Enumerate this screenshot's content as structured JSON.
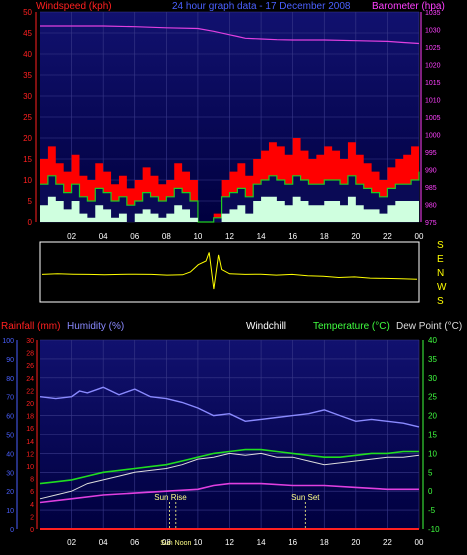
{
  "colors": {
    "background": "#000000",
    "panel_top": "#10106e",
    "panel_bottom": "#000048",
    "grid": "#3a3a8a",
    "axis_red": "#ff2020",
    "axis_magenta": "#ff40ff",
    "axis_blue": "#4a60ff",
    "axis_green": "#40ff40",
    "axis_white": "#ffffff",
    "axis_yellow": "#ffff00",
    "humidity": "#8a8aff",
    "temperature": "#20dd20",
    "dew_point": "#dddddd",
    "barometer": "#e040e0",
    "wind_gust": "#ff0000",
    "wind_avg": "#20cc20",
    "wind_low": "#cfffdf",
    "wind_dir": "#ffff00"
  },
  "header": {
    "windspeed_label": "Windspeed (kph)",
    "title": "24 hour graph data - 17 December 2008",
    "barometer_label": "Barometer (hpa)"
  },
  "bottom_header": {
    "rainfall_label": "Rainfall (mm)",
    "humidity_label": "Humidity (%)",
    "windchill_label": "Windchill",
    "temperature_label": "Temperature (°C)",
    "dewpoint_label": "Dew Point (°C)"
  },
  "direction_labels": [
    "S",
    "E",
    "N",
    "W",
    "S"
  ],
  "annotations": {
    "sunrise": "Sun Rise",
    "sunset": "Sun Set",
    "noon": "Sun Noon"
  },
  "chart_data": [
    {
      "type": "area",
      "panel": "wind_and_pressure",
      "x_ticks": [
        "02",
        "04",
        "06",
        "08",
        "10",
        "12",
        "14",
        "16",
        "18",
        "20",
        "22",
        "00"
      ],
      "left_axis": {
        "label": "Windspeed (kph)",
        "ylim": [
          0,
          50
        ],
        "ticks": [
          0,
          5,
          10,
          15,
          20,
          25,
          30,
          35,
          40,
          45,
          50
        ]
      },
      "right_axis": {
        "label": "Barometer (hpa)",
        "ylim": [
          975,
          1035
        ],
        "ticks": [
          975,
          980,
          985,
          990,
          995,
          1000,
          1005,
          1010,
          1015,
          1020,
          1025,
          1030,
          1035
        ]
      },
      "series": [
        {
          "name": "Barometer (hpa)",
          "axis": "right",
          "x": [
            0,
            2,
            4,
            6,
            8,
            10,
            11,
            12,
            12.5,
            13,
            14,
            15,
            16,
            18,
            20,
            22,
            23,
            24
          ],
          "values": [
            1031,
            1031,
            1031,
            1030.8,
            1030.5,
            1030.3,
            1029.5,
            1028.5,
            1028,
            1027.5,
            1027.3,
            1027.1,
            1027,
            1027,
            1026.8,
            1026.6,
            1026.3,
            1026
          ]
        },
        {
          "name": "gust",
          "axis": "left",
          "x": [
            0,
            0.5,
            1,
            1.5,
            2,
            2.5,
            3,
            3.5,
            4,
            4.5,
            5,
            5.5,
            6,
            6.5,
            7,
            7.5,
            8,
            8.5,
            9,
            9.5,
            10,
            10.5,
            11,
            11.5,
            12,
            12.5,
            13,
            13.5,
            14,
            14.5,
            15,
            15.5,
            16,
            16.5,
            17,
            17.5,
            18,
            18.5,
            19,
            19.5,
            20,
            20.5,
            21,
            21.5,
            22,
            22.5,
            23,
            23.5,
            24
          ],
          "values": [
            15,
            18,
            14,
            12,
            16,
            11,
            10,
            14,
            12,
            9,
            11,
            8,
            10,
            13,
            11,
            9,
            10,
            14,
            12,
            10,
            0,
            0,
            2,
            10,
            12,
            14,
            11,
            15,
            17,
            19,
            18,
            16,
            20,
            17,
            15,
            16,
            18,
            17,
            15,
            19,
            16,
            14,
            12,
            10,
            13,
            15,
            16,
            18,
            20
          ]
        },
        {
          "name": "average",
          "axis": "left",
          "x": [
            0,
            0.5,
            1,
            1.5,
            2,
            2.5,
            3,
            3.5,
            4,
            4.5,
            5,
            5.5,
            6,
            6.5,
            7,
            7.5,
            8,
            8.5,
            9,
            9.5,
            10,
            10.5,
            11,
            11.5,
            12,
            12.5,
            13,
            13.5,
            14,
            14.5,
            15,
            15.5,
            16,
            16.5,
            17,
            17.5,
            18,
            18.5,
            19,
            19.5,
            20,
            20.5,
            21,
            21.5,
            22,
            22.5,
            23,
            23.5,
            24
          ],
          "values": [
            9,
            11,
            9,
            7,
            9,
            6,
            5,
            8,
            7,
            5,
            6,
            4,
            5,
            7,
            6,
            5,
            6,
            8,
            7,
            5,
            0,
            0,
            1,
            6,
            7,
            8,
            6,
            9,
            10,
            11,
            10,
            9,
            11,
            10,
            9,
            9,
            10,
            10,
            9,
            11,
            9,
            8,
            7,
            6,
            8,
            9,
            9,
            10,
            12
          ]
        },
        {
          "name": "low",
          "axis": "left",
          "x": [
            0,
            0.5,
            1,
            1.5,
            2,
            2.5,
            3,
            3.5,
            4,
            4.5,
            5,
            5.5,
            6,
            6.5,
            7,
            7.5,
            8,
            8.5,
            9,
            9.5,
            10,
            10.5,
            11,
            11.5,
            12,
            12.5,
            13,
            13.5,
            14,
            14.5,
            15,
            15.5,
            16,
            16.5,
            17,
            17.5,
            18,
            18.5,
            19,
            19.5,
            20,
            20.5,
            21,
            21.5,
            22,
            22.5,
            23,
            23.5,
            24
          ],
          "values": [
            4,
            6,
            5,
            3,
            5,
            2,
            1,
            4,
            3,
            1,
            2,
            0,
            2,
            3,
            2,
            1,
            2,
            4,
            3,
            1,
            0,
            0,
            0,
            2,
            3,
            4,
            2,
            5,
            6,
            6,
            5,
            4,
            6,
            5,
            4,
            4,
            5,
            5,
            4,
            6,
            4,
            3,
            3,
            2,
            4,
            5,
            5,
            5,
            7
          ]
        }
      ]
    },
    {
      "type": "line",
      "panel": "wind_direction",
      "y_categories": [
        "S",
        "E",
        "N",
        "W",
        "S"
      ],
      "ylim": [
        0,
        360
      ],
      "series": [
        {
          "name": "direction",
          "x": [
            0,
            1,
            2,
            3,
            4,
            5,
            6,
            7,
            8,
            9,
            9.5,
            10,
            10.5,
            10.7,
            11,
            11.3,
            11.5,
            12,
            13,
            14,
            15,
            16,
            17,
            18,
            19,
            20,
            21,
            22,
            23,
            24
          ],
          "values": [
            200,
            195,
            198,
            200,
            202,
            200,
            198,
            200,
            205,
            203,
            180,
            120,
            90,
            20,
            320,
            40,
            160,
            195,
            200,
            198,
            205,
            200,
            210,
            215,
            225,
            220,
            230,
            232,
            235,
            240
          ]
        }
      ]
    },
    {
      "type": "line",
      "panel": "temperature_humidity",
      "x_ticks": [
        "02",
        "04",
        "06",
        "08",
        "10",
        "12",
        "14",
        "16",
        "18",
        "20",
        "22",
        "00"
      ],
      "left_axes": [
        {
          "label": "Rainfall (mm)",
          "ylim": [
            0,
            30
          ],
          "ticks": [
            0,
            2,
            4,
            6,
            8,
            10,
            12,
            14,
            16,
            18,
            20,
            22,
            24,
            26,
            28,
            30
          ]
        },
        {
          "label": "Humidity (%)",
          "ylim": [
            0,
            100
          ],
          "ticks": [
            0,
            10,
            20,
            30,
            40,
            50,
            60,
            70,
            80,
            90,
            100
          ]
        }
      ],
      "right_axis": {
        "label": "Temperature (°C)",
        "ylim": [
          -10,
          40
        ],
        "ticks": [
          -10,
          -5,
          0,
          5,
          10,
          15,
          20,
          25,
          30,
          35,
          40
        ]
      },
      "series": [
        {
          "name": "Humidity (%)",
          "axis": "humidity",
          "x": [
            0,
            1,
            2,
            2.5,
            3,
            4,
            5,
            6,
            7,
            8,
            9,
            10,
            11,
            12,
            13,
            14,
            15,
            16,
            17,
            18,
            19,
            20,
            21,
            22,
            23,
            24
          ],
          "values": [
            70,
            69,
            70,
            73,
            72,
            75,
            71,
            74,
            70,
            69,
            67,
            64,
            60,
            61,
            57,
            58,
            59,
            60,
            61,
            63,
            60,
            57,
            58,
            57,
            56,
            54
          ]
        },
        {
          "name": "Temperature (°C)",
          "axis": "temp",
          "x": [
            0,
            1,
            2,
            3,
            4,
            5,
            6,
            7,
            8,
            9,
            10,
            11,
            12,
            13,
            14,
            15,
            16,
            17,
            18,
            19,
            20,
            21,
            22,
            23,
            24
          ],
          "values": [
            2,
            2.5,
            3,
            4,
            5,
            5.5,
            6,
            6.5,
            7,
            8,
            9,
            10,
            10.5,
            11,
            11,
            10.5,
            10,
            9.5,
            9,
            9,
            9.5,
            10,
            10,
            10.5,
            10.5
          ]
        },
        {
          "name": "Dew Point (°C)",
          "axis": "temp",
          "x": [
            0,
            1,
            2,
            3,
            4,
            5,
            6,
            7,
            8,
            9,
            10,
            11,
            12,
            13,
            14,
            15,
            16,
            17,
            18,
            19,
            20,
            21,
            22,
            23,
            24
          ],
          "values": [
            -2,
            -1,
            0,
            2,
            3,
            4,
            5,
            5.5,
            6,
            7,
            8.5,
            9,
            10,
            9.5,
            10,
            9,
            9,
            8,
            7,
            7.5,
            8,
            8.5,
            9,
            9,
            9.5
          ]
        },
        {
          "name": "Rainfall (mm)",
          "axis": "rain",
          "x": [
            0,
            24
          ],
          "values": [
            0,
            0
          ]
        },
        {
          "name": "Windchill",
          "axis": "temp",
          "x": [
            0,
            2,
            4,
            6,
            8,
            10,
            11,
            12,
            14,
            16,
            18,
            20,
            22,
            24
          ],
          "values": [
            -3,
            -2,
            -1,
            -0.5,
            0,
            0.5,
            1.5,
            2,
            2,
            1.5,
            1.5,
            1,
            0.5,
            0.5
          ]
        }
      ],
      "markers": [
        {
          "label": "Sun Rise",
          "x": 8.2
        },
        {
          "label": "Sun Noon",
          "x": 8.6
        },
        {
          "label": "Sun Set",
          "x": 16.8
        }
      ]
    }
  ]
}
